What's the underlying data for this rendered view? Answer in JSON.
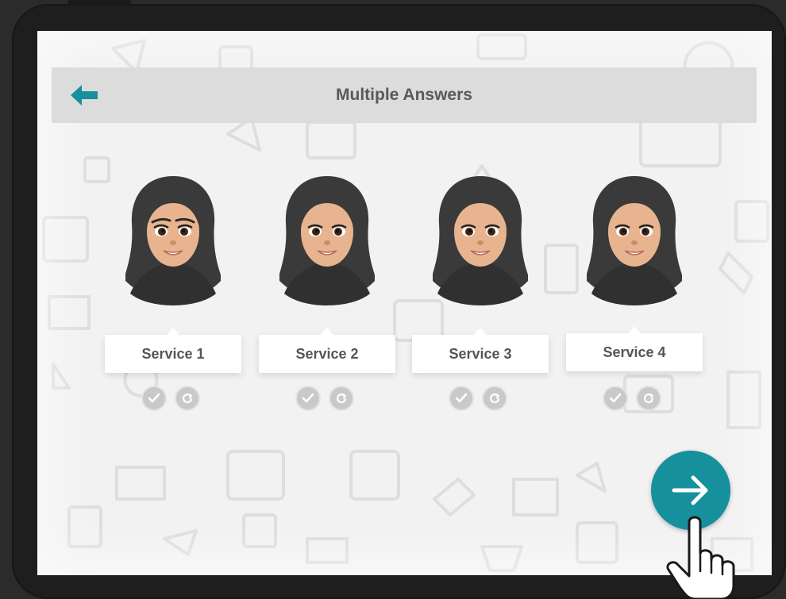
{
  "screen": {
    "title": "Multiple Answers"
  },
  "services": [
    {
      "label": "Service 1"
    },
    {
      "label": "Service 2"
    },
    {
      "label": "Service 3"
    },
    {
      "label": "Service 4"
    }
  ],
  "icons": {
    "back": "arrow-left-icon",
    "next": "arrow-right-icon",
    "check": "check-icon",
    "reset": "refresh-icon",
    "pointer": "hand-pointer-icon"
  },
  "colors": {
    "accent": "#15909c",
    "header_bg": "#dcdcdc",
    "title_text": "#595959",
    "scarf": "#3a3a3a",
    "skin": "#e8b48f"
  }
}
